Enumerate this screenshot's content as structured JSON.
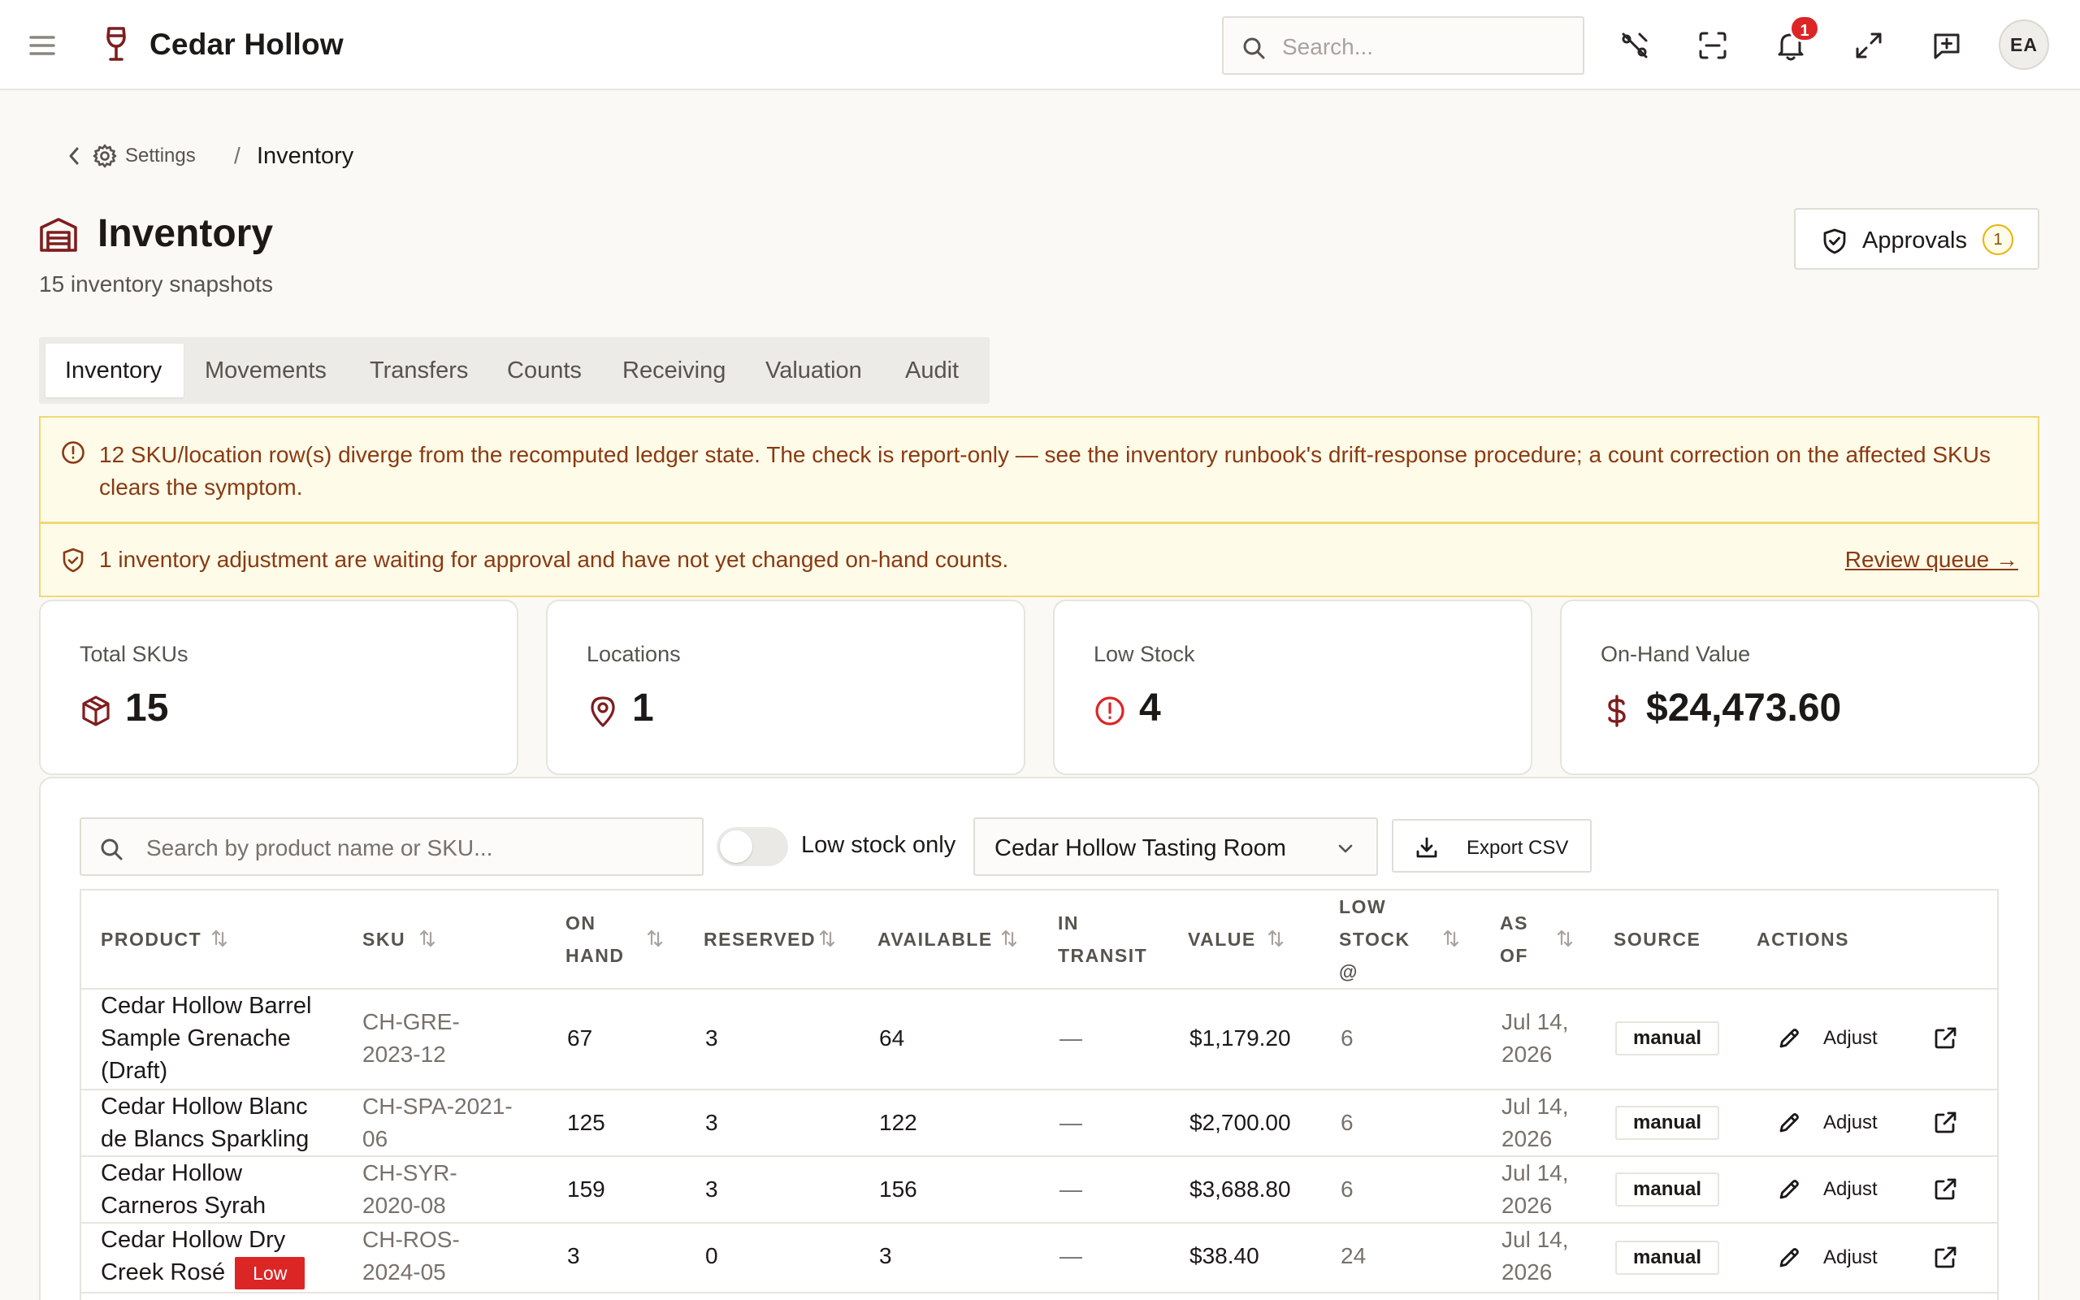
{
  "header": {
    "app_title": "Cedar Hollow",
    "search_placeholder": "Search...",
    "notifications_count": "1",
    "avatar_initials": "EA"
  },
  "breadcrumb": {
    "parent": "Settings",
    "separator": "/",
    "current": "Inventory"
  },
  "page": {
    "title": "Inventory",
    "subtitle": "15 inventory snapshots",
    "approvals_label": "Approvals",
    "approvals_count": "1"
  },
  "tabs": [
    {
      "label": "Inventory",
      "active": true
    },
    {
      "label": "Movements",
      "active": false
    },
    {
      "label": "Transfers",
      "active": false
    },
    {
      "label": "Counts",
      "active": false
    },
    {
      "label": "Receiving",
      "active": false
    },
    {
      "label": "Valuation",
      "active": false
    },
    {
      "label": "Audit",
      "active": false
    }
  ],
  "alerts": {
    "drift": "12 SKU/location row(s) diverge from the recomputed ledger state. The check is report-only — see the inventory runbook's drift-response procedure; a count correction on the affected SKUs clears the symptom.",
    "approval": "1 inventory adjustment are waiting for approval and have not yet changed on-hand counts.",
    "approval_link": "Review queue →"
  },
  "stats": {
    "total_skus": {
      "label": "Total SKUs",
      "value": "15",
      "icon": "box-icon"
    },
    "locations": {
      "label": "Locations",
      "value": "1",
      "icon": "map-pin-icon"
    },
    "low_stock": {
      "label": "Low Stock",
      "value": "4",
      "icon": "alert-circle-icon"
    },
    "on_hand_value": {
      "label": "On-Hand Value",
      "value": "$24,473.60",
      "icon": "dollar-icon"
    }
  },
  "filters": {
    "search_placeholder": "Search by product name or SKU...",
    "low_stock_only_label": "Low stock only",
    "low_stock_only": false,
    "location": "Cedar Hollow Tasting Room",
    "export_label": "Export CSV"
  },
  "table": {
    "columns": {
      "product": "PRODUCT",
      "sku": "SKU",
      "on_hand_1": "ON",
      "on_hand_2": "HAND",
      "reserved": "RESERVED",
      "available": "AVAILABLE",
      "in_transit_1": "IN",
      "in_transit_2": "TRANSIT",
      "value": "VALUE",
      "low_stock_1": "LOW",
      "low_stock_2": "STOCK",
      "low_stock_3": "@",
      "as_of_1": "AS",
      "as_of_2": "OF",
      "source": "SOURCE",
      "actions": "ACTIONS"
    },
    "adjust_label": "Adjust",
    "low_tag": "Low",
    "rows": [
      {
        "product": [
          "Cedar Hollow Barrel",
          "Sample Grenache",
          "(Draft)"
        ],
        "sku": [
          "CH-GRE-",
          "2023-12"
        ],
        "on_hand": "67",
        "reserved": "3",
        "available": "64",
        "in_transit": "—",
        "value": "$1,179.20",
        "low_stock_at": "6",
        "as_of": [
          "Jul 14,",
          "2026"
        ],
        "source": "manual",
        "low": false
      },
      {
        "product": [
          "Cedar Hollow Blanc",
          "de Blancs Sparkling"
        ],
        "sku": [
          "CH-SPA-2021-",
          "06"
        ],
        "on_hand": "125",
        "reserved": "3",
        "available": "122",
        "in_transit": "—",
        "value": "$2,700.00",
        "low_stock_at": "6",
        "as_of": [
          "Jul 14,",
          "2026"
        ],
        "source": "manual",
        "low": false
      },
      {
        "product": [
          "Cedar Hollow",
          "Carneros Syrah"
        ],
        "sku": [
          "CH-SYR-",
          "2020-08"
        ],
        "on_hand": "159",
        "reserved": "3",
        "available": "156",
        "in_transit": "—",
        "value": "$3,688.80",
        "low_stock_at": "6",
        "as_of": [
          "Jul 14,",
          "2026"
        ],
        "source": "manual",
        "low": false
      },
      {
        "product": [
          "Cedar Hollow Dry",
          "Creek Rosé"
        ],
        "sku": [
          "CH-ROS-",
          "2024-05"
        ],
        "on_hand": "3",
        "reserved": "0",
        "available": "3",
        "in_transit": "—",
        "value": "$38.40",
        "low_stock_at": "24",
        "as_of": [
          "Jul 14,",
          "2026"
        ],
        "source": "manual",
        "low": true
      }
    ]
  },
  "colors": {
    "brand": "#7f1d1d",
    "alert_bg": "#fefbe8",
    "alert_border": "#f2d774",
    "alert_text": "#8a3a12",
    "danger": "#dc2626"
  }
}
